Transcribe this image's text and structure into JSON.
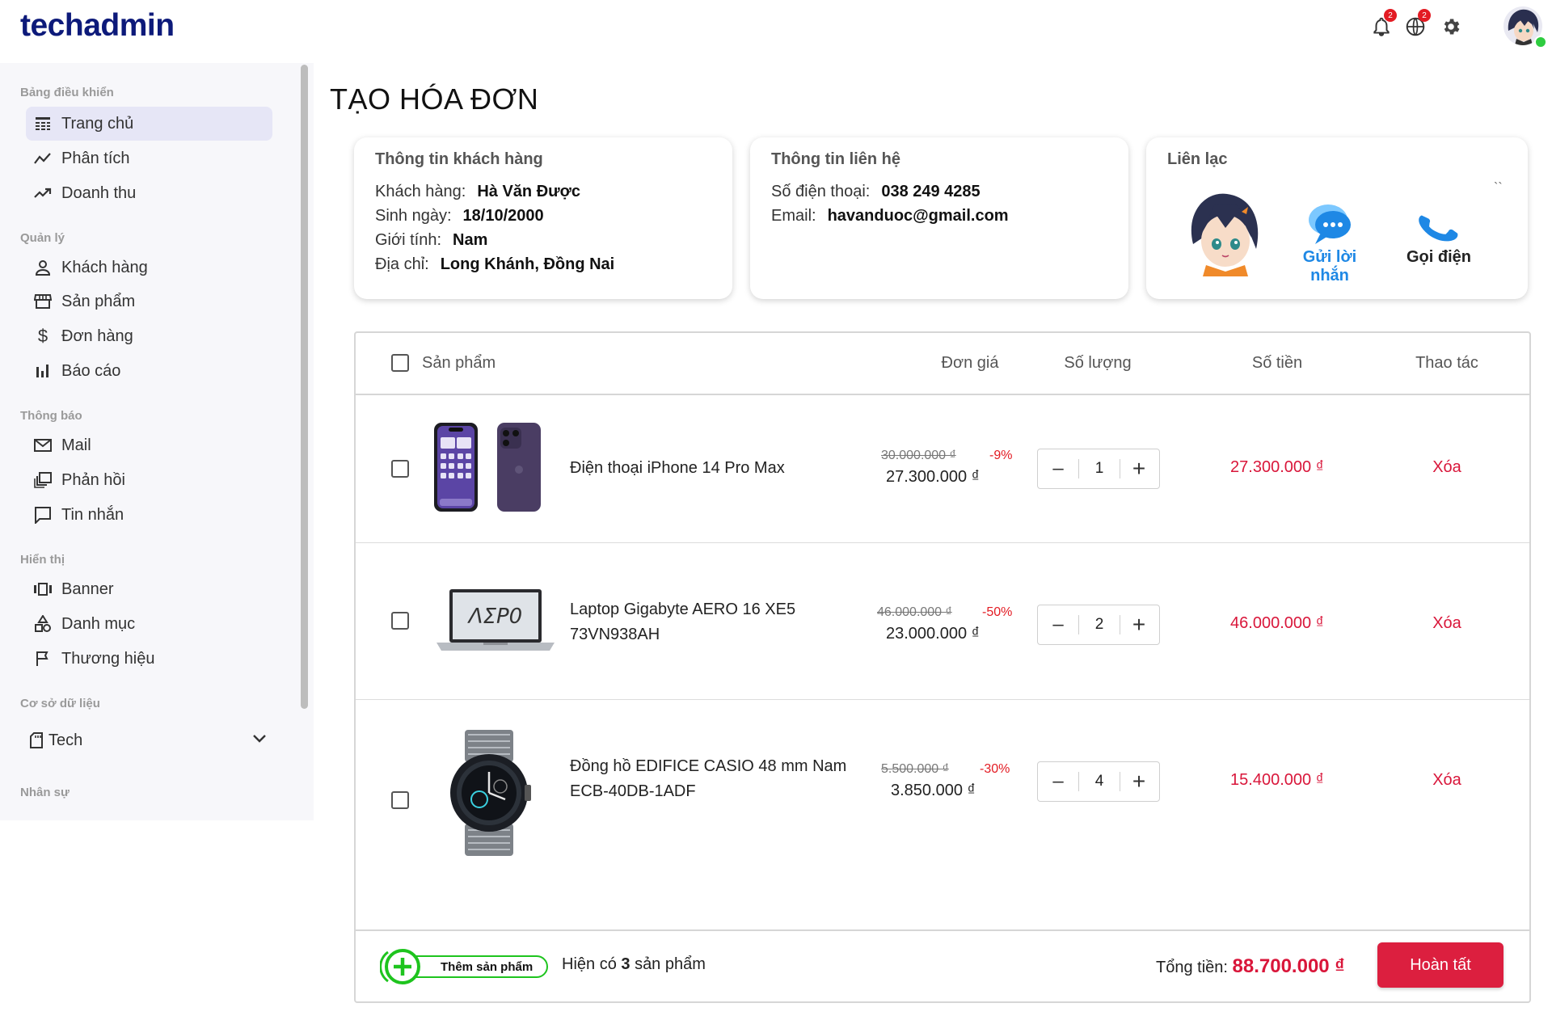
{
  "app": {
    "logo": "techadmin",
    "notification_badge": "2",
    "language_badge": "2"
  },
  "sidebar": {
    "sections": [
      "Bảng điều khiển",
      "Quản lý",
      "Thông báo",
      "Hiển thị",
      "Cơ sở dữ liệu",
      "Nhân sự"
    ],
    "items": [
      {
        "label": "Trang chủ",
        "icon": "table-icon",
        "active": true
      },
      {
        "label": "Phân tích",
        "icon": "trend-icon"
      },
      {
        "label": "Doanh thu",
        "icon": "trend-up-icon"
      },
      {
        "label": "Khách hàng",
        "icon": "user-icon"
      },
      {
        "label": "Sản phẩm",
        "icon": "store-icon"
      },
      {
        "label": "Đơn hàng",
        "icon": "dollar-icon"
      },
      {
        "label": "Báo cáo",
        "icon": "bar-chart-icon"
      },
      {
        "label": "Mail",
        "icon": "mail-icon"
      },
      {
        "label": "Phản hồi",
        "icon": "feedback-icon"
      },
      {
        "label": "Tin nhắn",
        "icon": "message-icon"
      },
      {
        "label": "Banner",
        "icon": "carousel-icon"
      },
      {
        "label": "Danh mục",
        "icon": "category-icon"
      },
      {
        "label": "Thương hiệu",
        "icon": "flag-icon"
      },
      {
        "label": "Tech",
        "icon": "sd-card-icon"
      }
    ]
  },
  "page": {
    "title": "TẠO HÓA ĐƠN"
  },
  "customer": {
    "title": "Thông tin khách hàng",
    "name_label": "Khách hàng:",
    "name": "Hà Văn Được",
    "birth_label": "Sinh ngày:",
    "birth": "18/10/2000",
    "gender_label": "Giới tính:",
    "gender": "Nam",
    "address_label": "Địa chỉ:",
    "address": "Long Khánh, Đồng Nai"
  },
  "contact": {
    "title": "Thông tin liên hệ",
    "phone_label": "Số điện thoại:",
    "phone": "038 249 4285",
    "email_label": "Email:",
    "email": "havanduoc@gmail.com"
  },
  "reach": {
    "title": "Liên lạc",
    "message_label": "Gửi lời nhắn",
    "call_label": "Gọi điện",
    "mark": "``"
  },
  "table": {
    "headers": {
      "product": "Sản phẩm",
      "unit_price": "Đơn giá",
      "quantity": "Số lượng",
      "amount": "Số tiền",
      "action": "Thao tác"
    },
    "rows": [
      {
        "name": "Điện thoại iPhone 14 Pro Max",
        "old_price": "30.000.000 ₫",
        "discount": "-9%",
        "price": "27.300.000 ₫",
        "quantity": "1",
        "amount": "27.300.000 ₫",
        "action": "Xóa",
        "minus": "–",
        "plus": "+"
      },
      {
        "name": "Laptop Gigabyte AERO 16 XE5 73VN938AH",
        "old_price": "46.000.000 ₫",
        "discount": "-50%",
        "price": "23.000.000 ₫",
        "quantity": "2",
        "amount": "46.000.000 ₫",
        "action": "Xóa",
        "minus": "–",
        "plus": "+"
      },
      {
        "name": "Đồng hồ EDIFICE CASIO 48 mm Nam ECB-40DB-1ADF",
        "old_price": "5.500.000 ₫",
        "discount": "-30%",
        "price": "3.850.000 ₫",
        "quantity": "4",
        "amount": "15.400.000 ₫",
        "action": "Xóa",
        "minus": "–",
        "plus": "+"
      }
    ]
  },
  "footer": {
    "add_label": "Thêm sản phẩm",
    "count_prefix": "Hiện có",
    "count": "3",
    "count_suffix": "sản phẩm",
    "total_label": "Tổng tiền:",
    "total": "88.700.000 ₫",
    "done_label": "Hoàn tất"
  },
  "colors": {
    "accent": "#dc1f3f",
    "brand": "#0d1a7a",
    "link": "#1e88e5",
    "add_green": "#1ec41e"
  }
}
